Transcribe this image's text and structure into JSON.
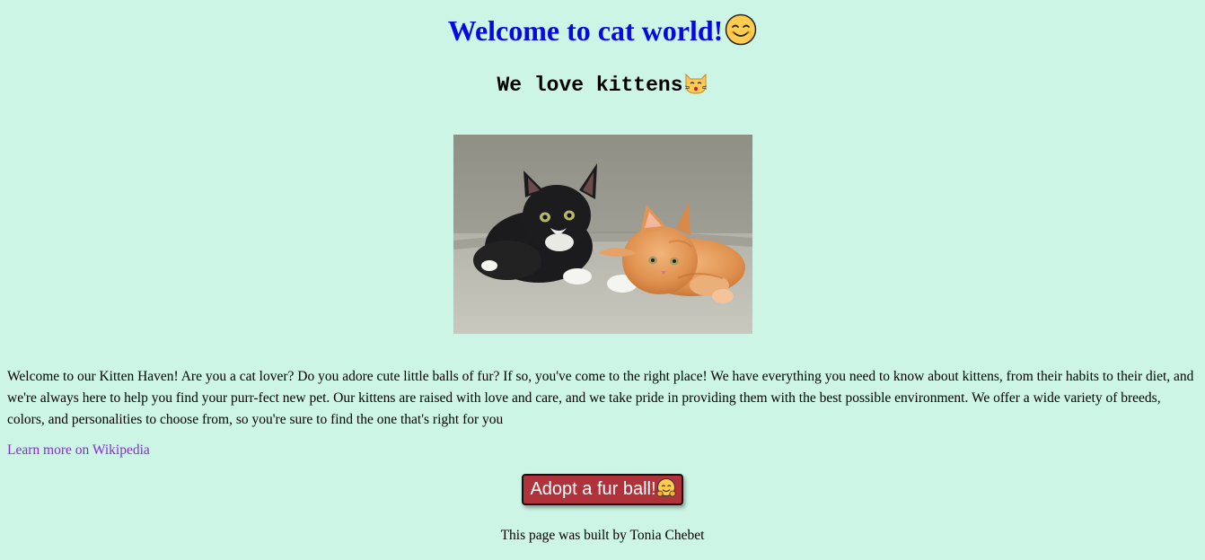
{
  "header": {
    "title": "Welcome to cat world!",
    "title_icon": "smiling-face-icon",
    "subtitle": "We love kittens",
    "subtitle_icon": "kissing-cat-icon"
  },
  "main": {
    "image_subject": "kittens-photo",
    "intro_text": "Welcome to our Kitten Haven! Are you a cat lover? Do you adore cute little balls of fur? If so, you've come to the right place! We have everything you need to know about kittens, from their habits to their diet, and we're always here to help you find your purr-fect new pet. Our kittens are raised with love and care, and we take pride in providing them with the best possible environment. We offer a wide variety of breeds, colors, and personalities to choose from, so you're sure to find the one that's right for you",
    "link_text": "Learn more on Wikipedia",
    "button_label": "Adopt a fur ball!",
    "button_icon": "hugging-face-icon"
  },
  "footer": {
    "text": "This page was built by Tonia Chebet"
  },
  "colors": {
    "background": "#ccf5e6",
    "title": "#0808e6",
    "link": "#8c28dc",
    "button": "#b0323a"
  }
}
